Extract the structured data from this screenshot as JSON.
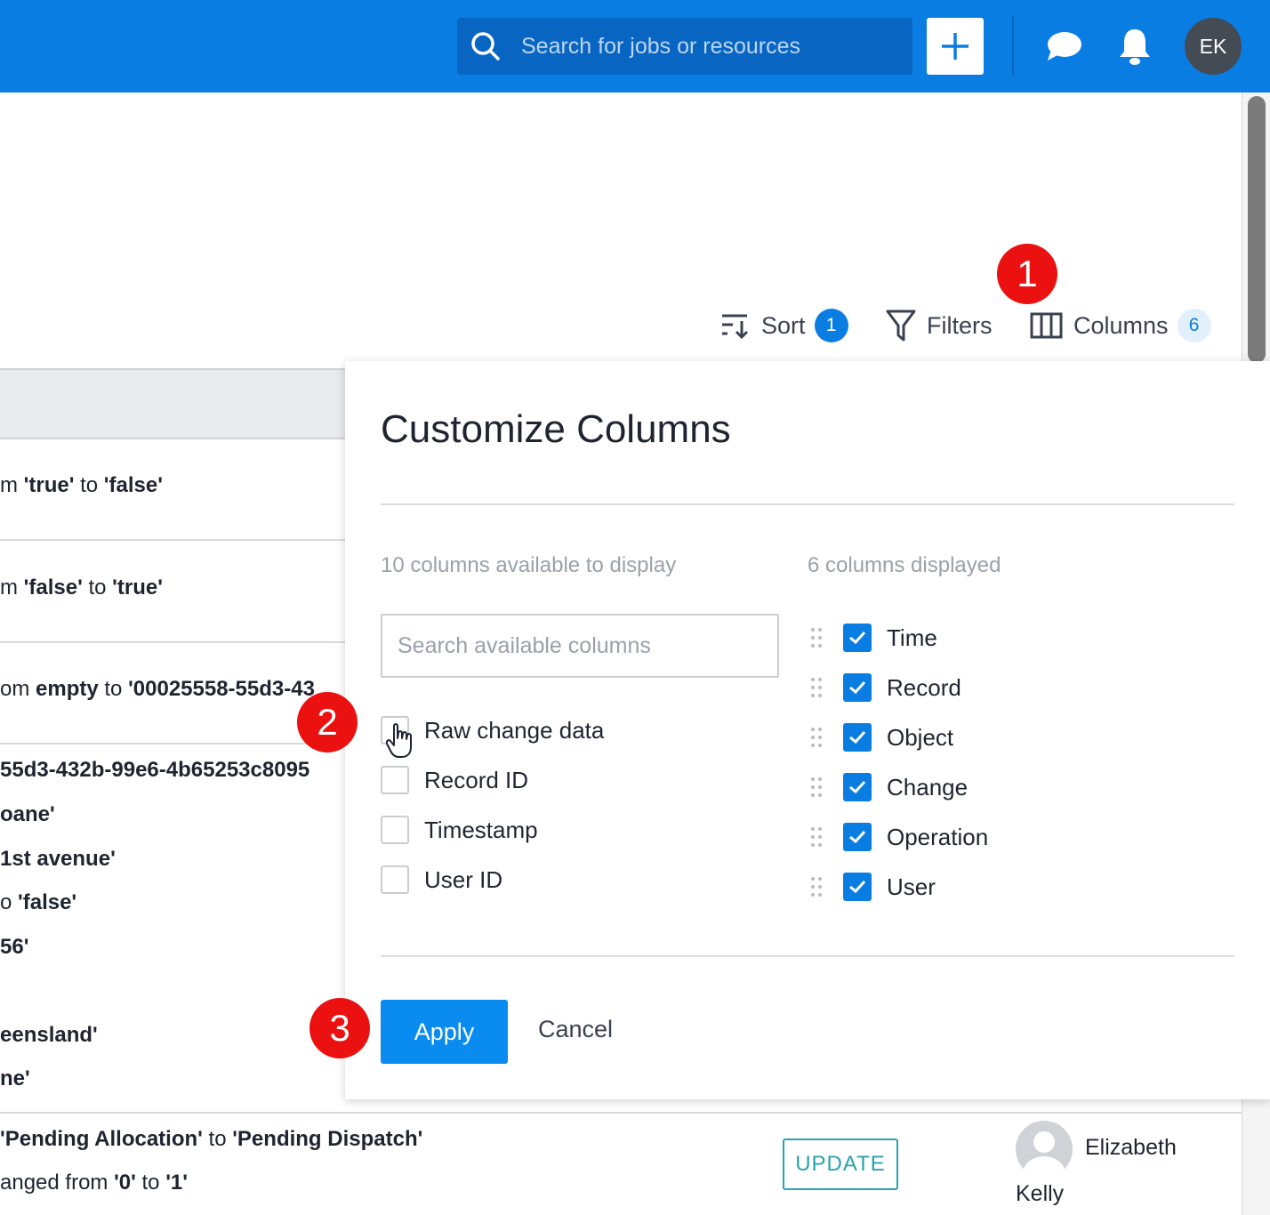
{
  "topbar": {
    "search_placeholder": "Search for jobs or resources",
    "avatar_initials": "EK",
    "brand_color": "#0a7de3"
  },
  "toolbar": {
    "sort_label": "Sort",
    "sort_count": "1",
    "filters_label": "Filters",
    "columns_label": "Columns",
    "columns_count": "6"
  },
  "steps": [
    "1",
    "2",
    "3"
  ],
  "background_rows": {
    "row1": {
      "prefix": "m ",
      "from": "'true'",
      "mid": " to ",
      "to": "'false'"
    },
    "row2": {
      "prefix": "m ",
      "from": "'false'",
      "mid": " to ",
      "to": "'true'"
    },
    "row3": {
      "prefix": "om ",
      "from": "empty",
      "mid": " to ",
      "to": "'00025558-55d3-43"
    },
    "row4": {
      "text": "55d3-432b-99e6-4b65253c8095"
    },
    "row5": {
      "text": "oane'"
    },
    "row6": {
      "text": "1st avenue'"
    },
    "row7": {
      "prefix": "o ",
      "value": "'false'"
    },
    "row8": {
      "text": "56'"
    },
    "row9": {
      "text": "eensland'"
    },
    "row10": {
      "text": "ne'"
    },
    "row11": {
      "from": "'Pending Allocation'",
      "mid": " to ",
      "to": "'Pending Dispatch'"
    },
    "row12": {
      "prefix": "anged from ",
      "from": "'0'",
      "mid": " to ",
      "to": "'1'"
    },
    "operation_badge": "UPDATE",
    "user_first": "Elizabeth",
    "user_last": "Kelly"
  },
  "modal": {
    "title": "Customize Columns",
    "available_heading": "10 columns available to display",
    "displayed_heading": "6 columns displayed",
    "search_placeholder": "Search available columns",
    "available": [
      "Raw change data",
      "Record ID",
      "Timestamp",
      "User ID"
    ],
    "displayed": [
      "Time",
      "Record",
      "Object",
      "Change",
      "Operation",
      "User"
    ],
    "apply_label": "Apply",
    "cancel_label": "Cancel"
  }
}
